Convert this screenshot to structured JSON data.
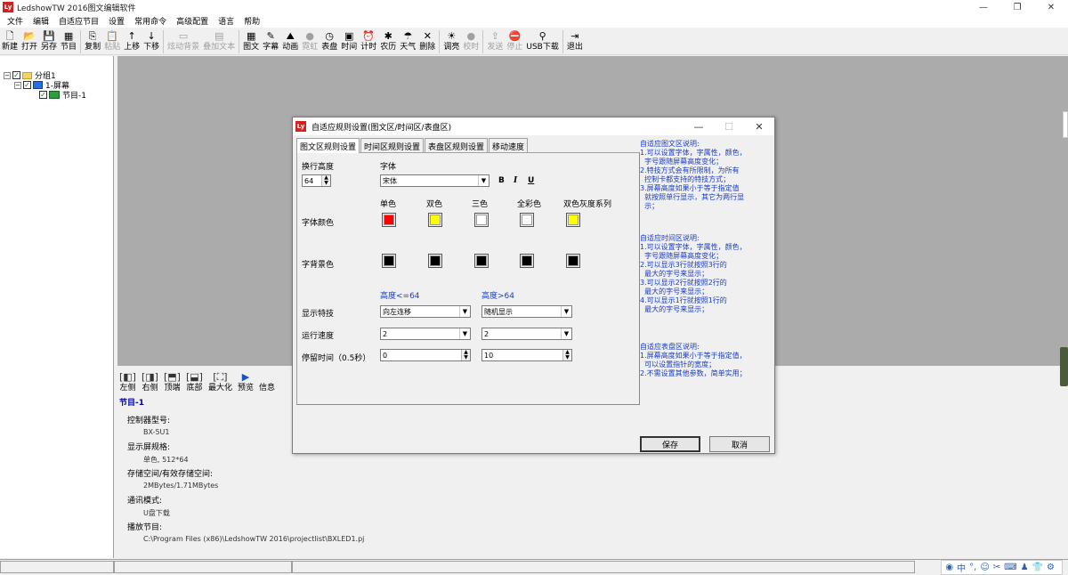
{
  "window": {
    "title": "LedshowTW 2016图文编辑软件",
    "logo_text": "Ly"
  },
  "menu": [
    "文件",
    "编辑",
    "自适应节目",
    "设置",
    "常用命令",
    "高级配置",
    "语言",
    "帮助"
  ],
  "toolbar": [
    {
      "icon": "new-file-icon",
      "glyph": "🗋",
      "label": "新建",
      "enabled": true
    },
    {
      "icon": "open-folder-icon",
      "glyph": "📂",
      "label": "打开",
      "enabled": true
    },
    {
      "icon": "save-icon",
      "glyph": "💾",
      "label": "另存",
      "enabled": true
    },
    {
      "icon": "program-icon",
      "glyph": "▦",
      "label": "节目",
      "enabled": true
    },
    {
      "icon": "copy-icon",
      "glyph": "⎘",
      "label": "复制",
      "enabled": true
    },
    {
      "icon": "paste-icon",
      "glyph": "📋",
      "label": "粘贴",
      "enabled": false
    },
    {
      "icon": "arrow-up-icon",
      "glyph": "↑",
      "label": "上移",
      "enabled": true
    },
    {
      "icon": "arrow-down-icon",
      "glyph": "↓",
      "label": "下移",
      "enabled": true
    },
    {
      "icon": "dazzle-bg-icon",
      "glyph": "▭",
      "label": "炫动背景",
      "enabled": false
    },
    {
      "icon": "overlay-text-icon",
      "glyph": "▤",
      "label": "叠加文本",
      "enabled": false
    },
    {
      "icon": "image-text-icon",
      "glyph": "▦",
      "label": "图文",
      "enabled": true
    },
    {
      "icon": "subtitle-icon",
      "glyph": "✎",
      "label": "字幕",
      "enabled": true
    },
    {
      "icon": "animation-icon",
      "glyph": "⛰",
      "label": "动画",
      "enabled": true
    },
    {
      "icon": "neon-icon",
      "glyph": "●",
      "label": "霓虹",
      "enabled": false
    },
    {
      "icon": "clock-icon",
      "glyph": "◷",
      "label": "表盘",
      "enabled": true
    },
    {
      "icon": "time-icon",
      "glyph": "▣",
      "label": "时间",
      "enabled": true
    },
    {
      "icon": "timer-icon",
      "glyph": "⏰",
      "label": "计时",
      "enabled": true
    },
    {
      "icon": "lunar-calendar-icon",
      "glyph": "✱",
      "label": "农历",
      "enabled": true
    },
    {
      "icon": "weather-icon",
      "glyph": "☂",
      "label": "天气",
      "enabled": true
    },
    {
      "icon": "delete-icon",
      "glyph": "✕",
      "label": "删除",
      "enabled": true
    },
    {
      "icon": "brightness-icon",
      "glyph": "☀",
      "label": "调亮",
      "enabled": true
    },
    {
      "icon": "calibrate-icon",
      "glyph": "●",
      "label": "校时",
      "enabled": false
    },
    {
      "icon": "send-icon",
      "glyph": "⇪",
      "label": "发送",
      "enabled": false
    },
    {
      "icon": "stop-icon",
      "glyph": "⛔",
      "label": "停止",
      "enabled": false
    },
    {
      "icon": "usb-icon",
      "glyph": "⚲",
      "label": "USB下载",
      "enabled": true
    },
    {
      "icon": "exit-icon",
      "glyph": "⇥",
      "label": "退出",
      "enabled": true
    }
  ],
  "tree": {
    "group": "分组1",
    "screen": "1-屏幕",
    "program": "节目-1"
  },
  "bottom_toolbar": [
    {
      "icon": "align-left-icon",
      "glyph": "[◧]",
      "label": "左侧"
    },
    {
      "icon": "align-right-icon",
      "glyph": "[◨]",
      "label": "右侧"
    },
    {
      "icon": "align-top-icon",
      "glyph": "[⬒]",
      "label": "顶端"
    },
    {
      "icon": "align-bottom-icon",
      "glyph": "[⬓]",
      "label": "底部"
    },
    {
      "icon": "maximize-icon",
      "glyph": "[⛶]",
      "label": "最大化"
    },
    {
      "icon": "preview-icon",
      "glyph": "▶",
      "label": "预览"
    },
    {
      "icon": "info-icon",
      "glyph": "",
      "label": "信息"
    }
  ],
  "program_info": {
    "title": "节目-1",
    "controller_label": "控制器型号:",
    "controller_value": "BX-5U1",
    "screen_spec_label": "显示屏规格:",
    "screen_spec_value": "单色, 512*64",
    "storage_label": "存储空间/有效存储空间:",
    "storage_value": "2MBytes/1.71MBytes",
    "comm_label": "通讯模式:",
    "comm_value": "U盘下载",
    "play_label": "播放节目:",
    "play_value": "C:\\Program Files (x86)\\LedshowTW 2016\\projectlist\\BXLED1.pj"
  },
  "dialog": {
    "title": "自适应规则设置(图文区/时间区/表盘区)",
    "tabs": [
      "图文区规则设置",
      "时间区规则设置",
      "表盘区规则设置",
      "移动速度"
    ],
    "line_height_label": "换行高度",
    "line_height_value": "64",
    "font_label": "字体",
    "font_value": "宋体",
    "bold_label": "B",
    "italic_label": "I",
    "underline_label": "U",
    "color_columns": [
      "单色",
      "双色",
      "三色",
      "全彩色",
      "双色灰度系列"
    ],
    "font_color_label": "字体颜色",
    "font_colors": [
      "#ff0000",
      "#ffff00",
      "#ffffff",
      "#ffffff",
      "#ffff00"
    ],
    "bg_color_label": "字背景色",
    "bg_colors": [
      "#000000",
      "#000000",
      "#000000",
      "#000000",
      "#000000"
    ],
    "height_low_label": "高度<=64",
    "height_high_label": "高度>64",
    "effect_label": "显示特技",
    "effect_low": "向左连移",
    "effect_high": "随机显示",
    "speed_label": "运行速度",
    "speed_low": "2",
    "speed_high": "2",
    "stay_label": "停留时间（0.5秒）",
    "stay_low": "0",
    "stay_high": "10",
    "help_graphic": "自适应图文区说明:\n1.可以设置字体，字属性，颜色，\n  字号跟随屏幕高度变化；\n2.特技方式会有所限制，为所有\n  控制卡都支持的特技方式；\n3.屏幕高度如果小于等于指定值\n  就按照单行显示，其它为两行显\n  示；",
    "help_time": "自适应时间区说明:\n1.可以设置字体，字属性，颜色，\n  字号跟随屏幕高度变化；\n2.可以显示3行就按照3行的\n  最大的字号来显示；\n3.可以显示2行就按照2行的\n  最大的字号来显示；\n4.可以显示1行就按照1行的\n  最大的字号来显示；",
    "help_clock": "自适应表盘区说明:\n1.屏幕高度如果小于等于指定值，\n  可以设置指针的宽度；\n2.不需设置其他参数，简单实用；",
    "save_label": "保存",
    "cancel_label": "取消"
  },
  "tray": [
    {
      "icon": "ime-logo-icon",
      "glyph": "◉"
    },
    {
      "icon": "chinese-mode-icon",
      "glyph": "中"
    },
    {
      "icon": "punctuation-icon",
      "glyph": "°,"
    },
    {
      "icon": "emoji-icon",
      "glyph": "☺"
    },
    {
      "icon": "tools-icon",
      "glyph": "✂"
    },
    {
      "icon": "keyboard-icon",
      "glyph": "⌨"
    },
    {
      "icon": "user-icon",
      "glyph": "♟"
    },
    {
      "icon": "skin-icon",
      "glyph": "👕"
    },
    {
      "icon": "settings-icon",
      "glyph": "⚙"
    }
  ]
}
